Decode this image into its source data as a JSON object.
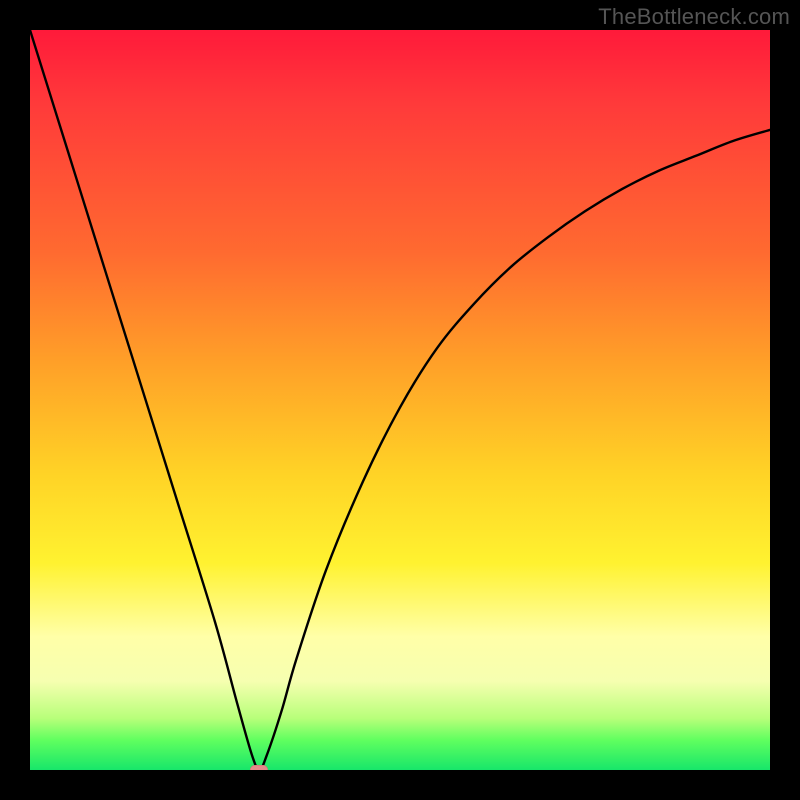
{
  "watermark": "TheBottleneck.com",
  "chart_data": {
    "type": "line",
    "title": "",
    "xlabel": "",
    "ylabel": "",
    "xlim": [
      0,
      100
    ],
    "ylim": [
      0,
      100
    ],
    "gradient_scale": {
      "top_color": "#ff1a3a",
      "bottom_color": "#17e66a",
      "meaning_top": "high-bottleneck",
      "meaning_bottom": "no-bottleneck"
    },
    "series": [
      {
        "name": "bottleneck-curve",
        "x": [
          0,
          5,
          10,
          15,
          20,
          25,
          28,
          30,
          31,
          32,
          34,
          36,
          40,
          45,
          50,
          55,
          60,
          65,
          70,
          75,
          80,
          85,
          90,
          95,
          100
        ],
        "values": [
          100,
          84,
          68,
          52,
          36,
          20,
          9,
          2,
          0,
          2,
          8,
          15,
          27,
          39,
          49,
          57,
          63,
          68,
          72,
          75.5,
          78.5,
          81,
          83,
          85,
          86.5
        ]
      }
    ],
    "minimum_marker": {
      "x": 31,
      "y": 0
    }
  }
}
